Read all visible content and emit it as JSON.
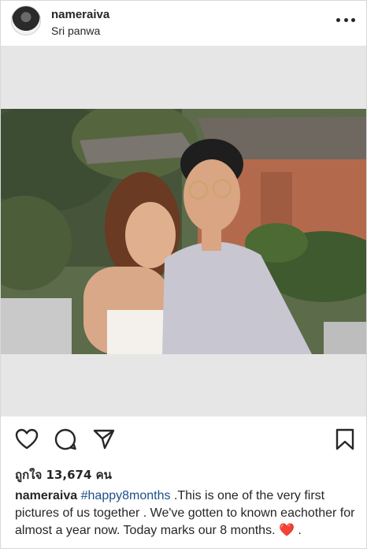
{
  "post": {
    "username": "nameraiva",
    "location": "Sri panwa",
    "likes_text": "ถูกใจ 13,674 คน",
    "caption": {
      "username": "nameraiva",
      "hashtag": "#happy8months",
      "text": " .This is one of the very first pictures of us together . We've gotten to known eachother for almost a year now. Today marks our 8 months. ",
      "emoji": "❤️",
      "trailing": " ."
    }
  },
  "icons": {
    "avatar": "profile-avatar",
    "more": "more-options-icon",
    "like": "heart-icon",
    "comment": "comment-icon",
    "share": "send-icon",
    "save": "bookmark-icon"
  },
  "colors": {
    "text": "#262626",
    "hashtag": "#1f4e8c",
    "photo_frame": "#e6e6e6",
    "emoji_heart": "#e0242e"
  }
}
